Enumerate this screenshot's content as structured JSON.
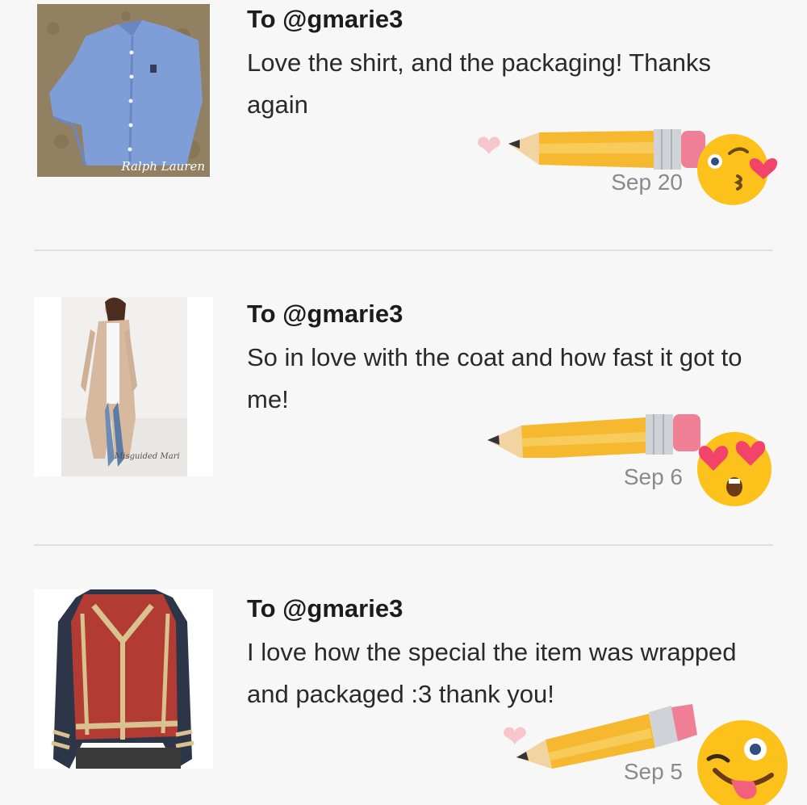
{
  "notes": [
    {
      "to": "To @gmarie3",
      "message": "Love the shirt, and the packaging! Thanks again",
      "date": "Sep 20",
      "image_caption": "Ralph Lauren",
      "image_icon": "blue-shirt-photo",
      "sticker": "kissing-face-emoji"
    },
    {
      "to": "To @gmarie3",
      "message": "So in love with the coat and how fast it got to me!",
      "date": "Sep 6",
      "image_caption": "Misguided Mari",
      "image_icon": "long-coat-photo",
      "sticker": "heart-eyes-emoji"
    },
    {
      "to": "To @gmarie3",
      "message": "I love how the special the item was wrapped and packaged :3 thank you!",
      "date": "Sep 5",
      "image_icon": "red-leather-jacket-photo",
      "sticker": "winking-tongue-emoji"
    }
  ],
  "colors": {
    "background": "#f7f7f7",
    "divider": "#e0e0e0",
    "heart": "#f6c6cc",
    "pencil": "#f5b82e",
    "emoji": "#fcc21b"
  }
}
